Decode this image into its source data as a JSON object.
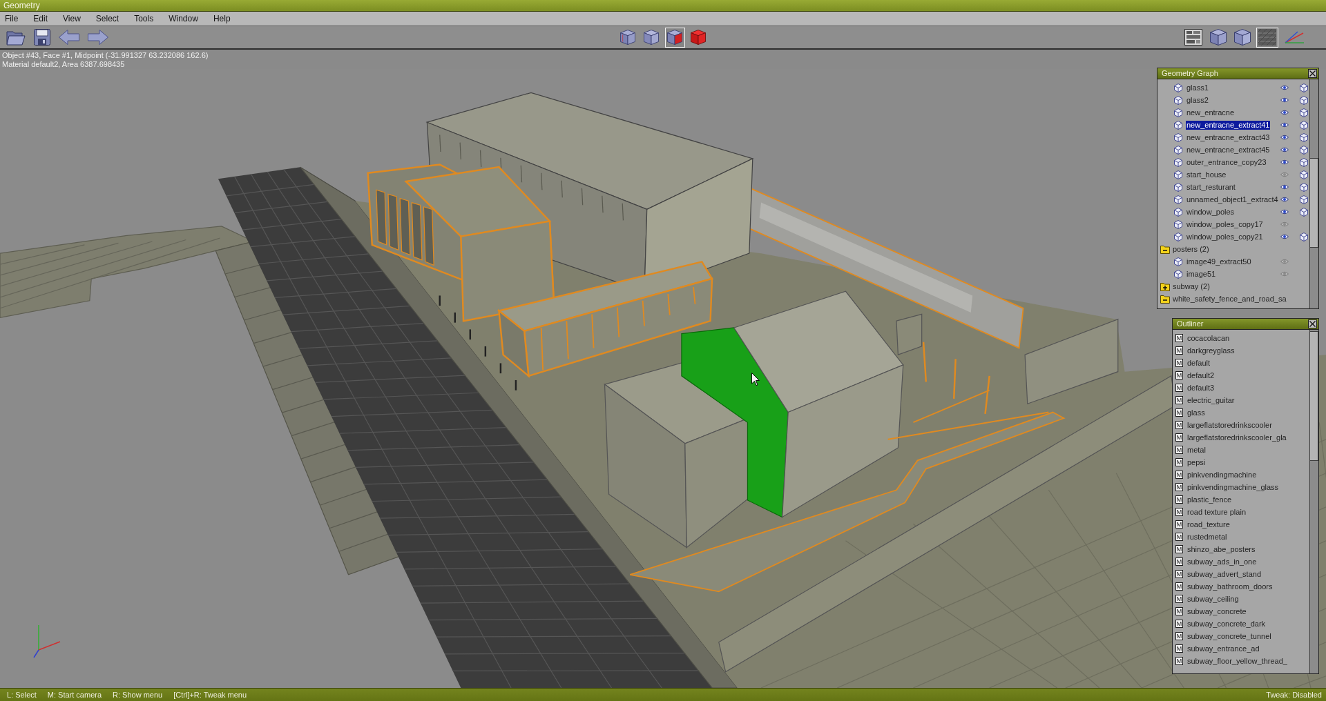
{
  "window": {
    "title": "Geometry"
  },
  "menu": [
    "File",
    "Edit",
    "View",
    "Select",
    "Tools",
    "Window",
    "Help"
  ],
  "toolbar": {
    "shading_modes": [
      {
        "selected": false
      },
      {
        "selected": false
      },
      {
        "selected": true
      },
      {
        "selected": false
      }
    ],
    "display_modes": [
      {
        "selected": false
      },
      {
        "selected": false
      },
      {
        "selected": false
      },
      {
        "selected": true
      },
      {
        "selected": false
      }
    ]
  },
  "selection_info": [
    "Object #43, Face #1, Midpoint (-31.991327 63.232086 162.6)",
    "Material default2, Area 6387.698435"
  ],
  "geometry_graph": {
    "title": "Geometry Graph",
    "tree": [
      {
        "children": [
          {
            "label": "glass1",
            "visible": true,
            "cube_on": true,
            "selected": false
          },
          {
            "label": "glass2",
            "visible": true,
            "cube_on": true,
            "selected": false
          },
          {
            "label": "new_entracne",
            "visible": true,
            "cube_on": true,
            "selected": false
          },
          {
            "label": "new_entracne_extract41",
            "visible": true,
            "cube_on": true,
            "selected": true
          },
          {
            "label": "new_entracne_extract43",
            "visible": true,
            "cube_on": true,
            "selected": false
          },
          {
            "label": "new_entracne_extract45",
            "visible": true,
            "cube_on": true,
            "selected": false
          },
          {
            "label": "outer_entrance_copy23",
            "visible": true,
            "cube_on": true,
            "selected": false
          },
          {
            "label": "start_house",
            "visible": false,
            "cube_on": true,
            "selected": false
          },
          {
            "label": "start_resturant",
            "visible": true,
            "cube_on": true,
            "selected": false
          },
          {
            "label": "unnamed_object1_extract4",
            "visible": true,
            "cube_on": true,
            "selected": false
          },
          {
            "label": "window_poles",
            "visible": true,
            "cube_on": true,
            "selected": false
          },
          {
            "label": "window_poles_copy17",
            "visible": false,
            "cube_on": false,
            "selected": false
          },
          {
            "label": "window_poles_copy21",
            "visible": true,
            "cube_on": true,
            "selected": false
          }
        ]
      },
      {
        "label": "posters (2)",
        "expanded": true,
        "selected": false,
        "children": [
          {
            "label": "image49_extract50",
            "visible": false,
            "cube_on": false,
            "selected": false
          },
          {
            "label": "image51",
            "visible": false,
            "cube_on": false,
            "selected": false
          }
        ]
      },
      {
        "label": "subway (2)",
        "expanded": false,
        "selected": false
      },
      {
        "label": "white_safety_fence_and_road_sa",
        "expanded": true,
        "selected": false
      }
    ]
  },
  "outliner": {
    "title": "Outliner",
    "items": [
      {
        "badge": "M",
        "label": "cocacolacan",
        "selected": false
      },
      {
        "badge": "M",
        "label": "darkgreyglass",
        "selected": false
      },
      {
        "badge": "M",
        "label": "default",
        "selected": false
      },
      {
        "badge": "M",
        "label": "default2",
        "selected": false
      },
      {
        "badge": "M",
        "label": "default3",
        "selected": false
      },
      {
        "badge": "M",
        "label": "electric_guitar",
        "selected": false
      },
      {
        "badge": "M",
        "label": "glass",
        "selected": false
      },
      {
        "badge": "M",
        "label": "largeflatstoredrinkscooler",
        "selected": false
      },
      {
        "badge": "M",
        "label": "largeflatstoredrinkscooler_gla",
        "selected": false
      },
      {
        "badge": "M",
        "label": "metal",
        "selected": false
      },
      {
        "badge": "M",
        "label": "pepsi",
        "selected": false
      },
      {
        "badge": "M",
        "label": "pinkvendingmachine",
        "selected": false
      },
      {
        "badge": "M",
        "label": "pinkvendingmachine_glass",
        "selected": false
      },
      {
        "badge": "M",
        "label": "plastic_fence",
        "selected": false
      },
      {
        "badge": "M",
        "label": "road texture plain",
        "selected": false
      },
      {
        "badge": "M",
        "label": "road_texture",
        "selected": false
      },
      {
        "badge": "M",
        "label": "rustedmetal",
        "selected": false
      },
      {
        "badge": "M",
        "label": "shinzo_abe_posters",
        "selected": false
      },
      {
        "badge": "M",
        "label": "subway_ads_in_one",
        "selected": false
      },
      {
        "badge": "M",
        "label": "subway_advert_stand",
        "selected": false
      },
      {
        "badge": "M",
        "label": "subway_bathroom_doors",
        "selected": false
      },
      {
        "badge": "M",
        "label": "subway_ceiling",
        "selected": false
      },
      {
        "badge": "M",
        "label": "subway_concrete",
        "selected": false
      },
      {
        "badge": "M",
        "label": "subway_concrete_dark",
        "selected": false
      },
      {
        "badge": "M",
        "label": "subway_concrete_tunnel",
        "selected": false
      },
      {
        "badge": "M",
        "label": "subway_entrance_ad",
        "selected": false
      },
      {
        "badge": "M",
        "label": "subway_floor_yellow_thread_",
        "selected": false
      }
    ]
  },
  "status_bar": {
    "hints": [
      "L: Select",
      "M: Start camera",
      "R: Show menu",
      "[Ctrl]+R: Tweak menu"
    ],
    "tweak": "Tweak: Disabled"
  }
}
